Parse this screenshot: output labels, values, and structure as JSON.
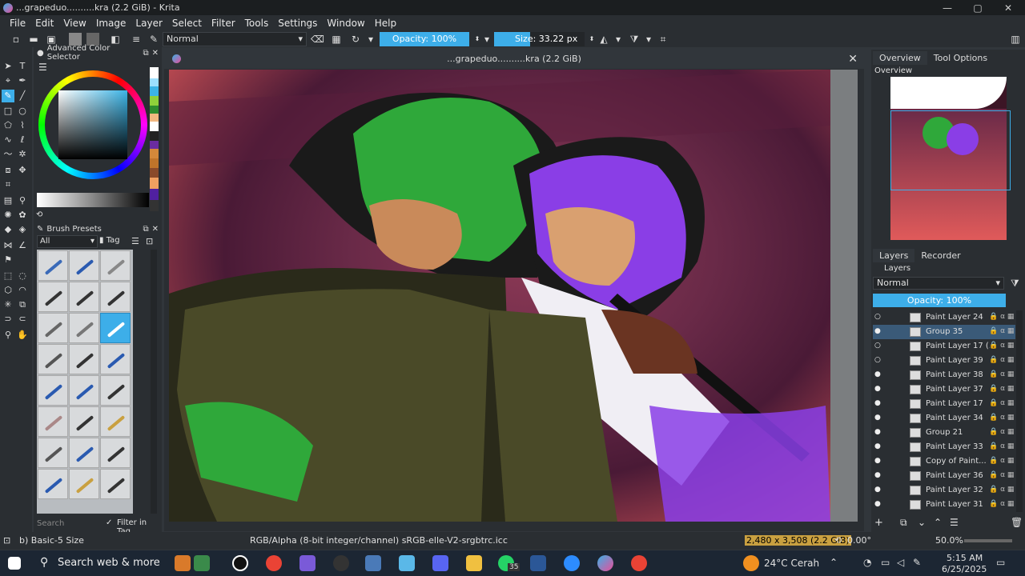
{
  "window": {
    "title": "...grapeduo..........kra (2.2 GiB) - Krita",
    "minimize": "—",
    "maximize": "▢",
    "close": "✕"
  },
  "menu": [
    "File",
    "Edit",
    "View",
    "Image",
    "Layer",
    "Select",
    "Filter",
    "Tools",
    "Settings",
    "Window",
    "Help"
  ],
  "toolbar": {
    "blend_mode": "Normal",
    "opacity": "Opacity: 100%",
    "size": "Size: 33.22 px"
  },
  "dockers": {
    "color_selector": "Advanced Color Selector",
    "brush_presets": "Brush Presets",
    "brush_filter": "All",
    "brush_tag": "Tag",
    "search_placeholder": "Search",
    "filter_in_tag": "Filter in Tag"
  },
  "canvas": {
    "title": "...grapeduo..........kra (2.2 GiB)"
  },
  "right": {
    "tabs": [
      "Overview",
      "Tool Options"
    ],
    "overview_label": "Overview",
    "layer_tabs": [
      "Layers",
      "Recorder"
    ],
    "layers_label": "Layers",
    "layer_blend": "Normal",
    "layer_opacity": "Opacity: 100%",
    "layers": [
      {
        "name": "Paint Layer 24",
        "visible": false,
        "selected": false
      },
      {
        "name": "Group 35",
        "visible": true,
        "selected": true
      },
      {
        "name": "Paint Layer 17 (...",
        "visible": false,
        "selected": false
      },
      {
        "name": "Paint Layer 39",
        "visible": false,
        "selected": false
      },
      {
        "name": "Paint Layer 38",
        "visible": true,
        "selected": false
      },
      {
        "name": "Paint Layer 37",
        "visible": true,
        "selected": false
      },
      {
        "name": "Paint Layer 17",
        "visible": true,
        "selected": false
      },
      {
        "name": "Paint Layer 34",
        "visible": true,
        "selected": false
      },
      {
        "name": "Group 21",
        "visible": true,
        "selected": false
      },
      {
        "name": "Paint Layer 33",
        "visible": true,
        "selected": false
      },
      {
        "name": "Copy of Paint...",
        "visible": true,
        "selected": false
      },
      {
        "name": "Paint Layer 36",
        "visible": true,
        "selected": false
      },
      {
        "name": "Paint Layer 32",
        "visible": true,
        "selected": false
      },
      {
        "name": "Paint Layer 31",
        "visible": true,
        "selected": false
      }
    ]
  },
  "status": {
    "brush": "b) Basic-5 Size",
    "color_space": "RGB/Alpha (8-bit integer/channel)  sRGB-elle-V2-srgbtrc.icc",
    "dimensions": "2,480 x 3,508 (2.2 GiB)",
    "rotation": "0.00°",
    "zoom": "50.0%"
  },
  "taskbar": {
    "search": "Search web & more",
    "weather": "24°C  Cerah",
    "time": "5:15 AM",
    "date": "6/25/2025",
    "badge": "35"
  }
}
